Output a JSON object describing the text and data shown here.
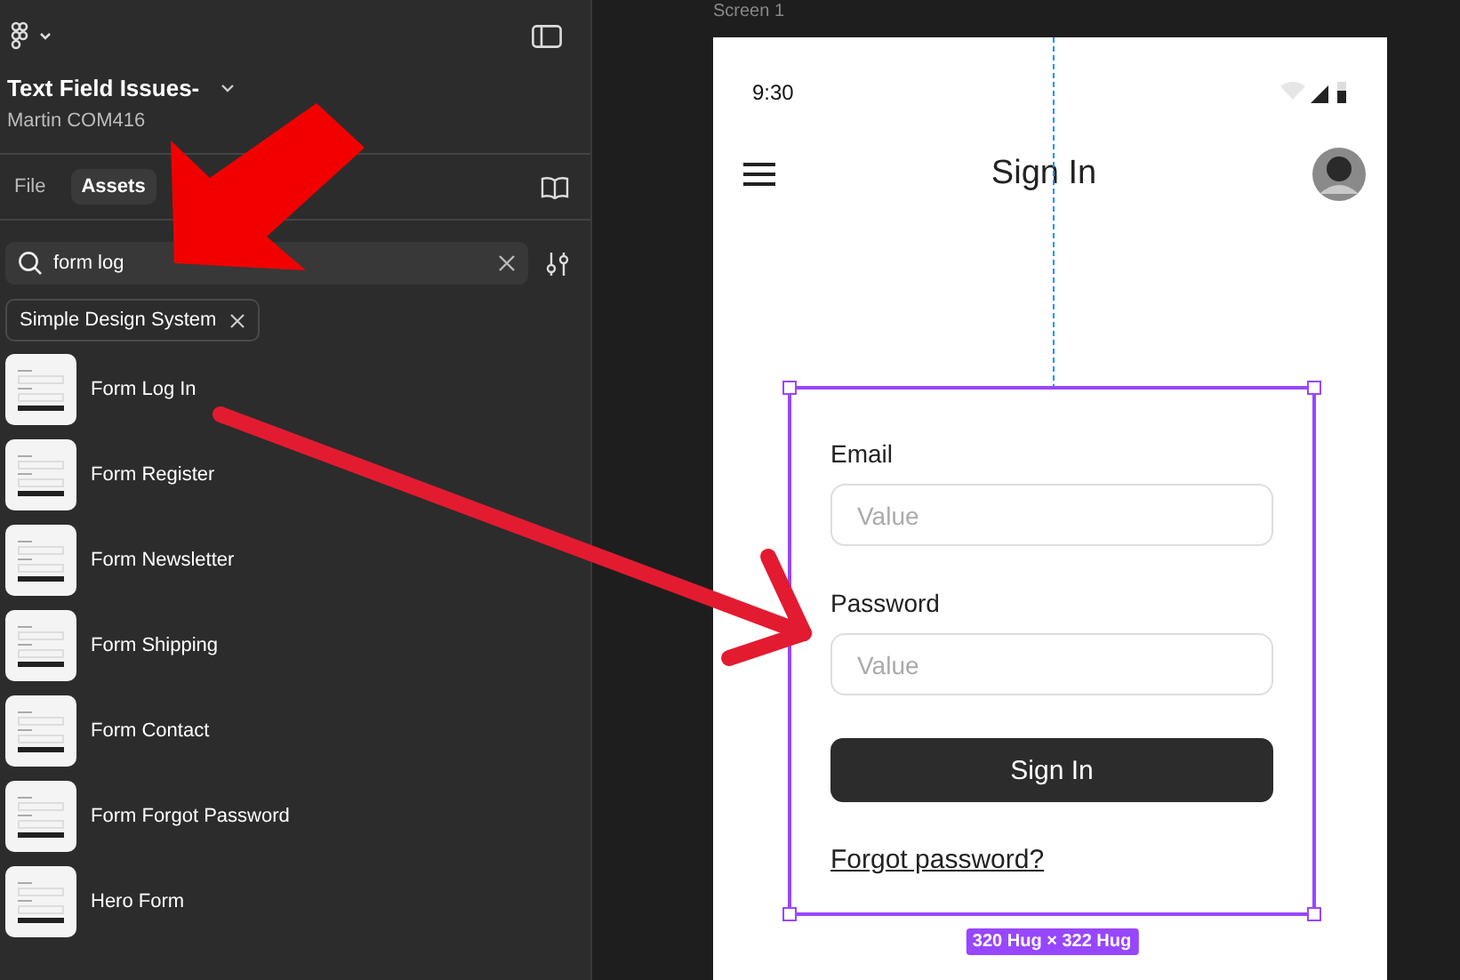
{
  "sidebar": {
    "file_title": "Text Field Issues-",
    "team": "Martin COM416",
    "tabs": [
      {
        "label": "File",
        "selected": false
      },
      {
        "label": "Assets",
        "selected": true
      }
    ],
    "search": {
      "value": "form log"
    },
    "filter_chip": "Simple Design System",
    "assets": [
      {
        "name": "Form Log In"
      },
      {
        "name": "Form Register"
      },
      {
        "name": "Form Newsletter"
      },
      {
        "name": "Form Shipping"
      },
      {
        "name": "Form Contact"
      },
      {
        "name": "Form Forgot Password"
      },
      {
        "name": "Hero Form"
      }
    ]
  },
  "canvas": {
    "frame_label": "Screen 1",
    "phone": {
      "time": "9:30",
      "title": "Sign In",
      "form": {
        "fields": [
          {
            "label": "Email",
            "placeholder": "Value"
          },
          {
            "label": "Password",
            "placeholder": "Value"
          }
        ],
        "button": "Sign In",
        "link": "Forgot password?",
        "size_badge": "320 Hug × 322 Hug"
      }
    }
  }
}
